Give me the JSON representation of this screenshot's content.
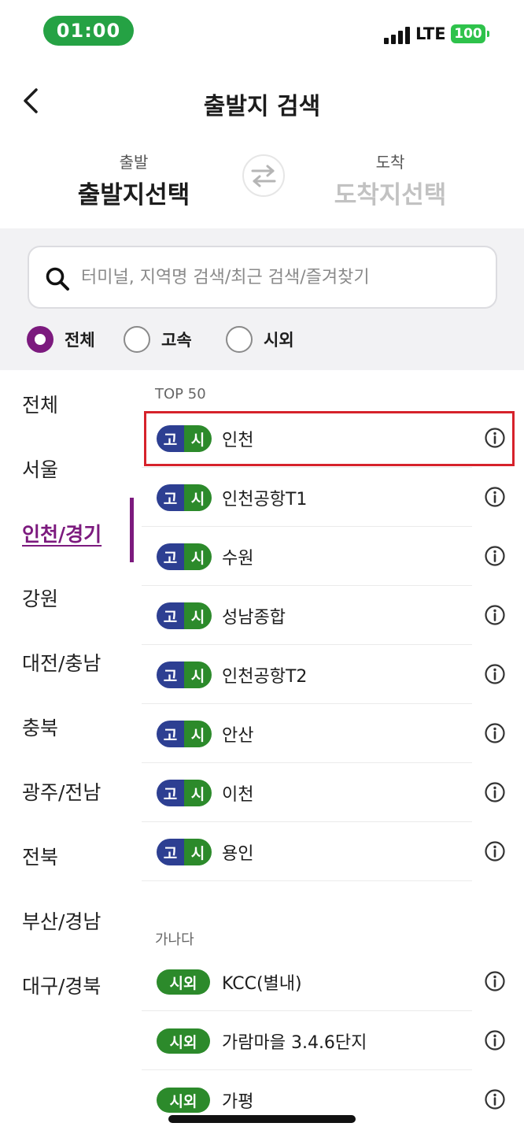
{
  "status_bar": {
    "time": "01:00",
    "network": "LTE",
    "battery": "100"
  },
  "header": {
    "title": "출발지 검색"
  },
  "route": {
    "departure_label": "출발",
    "departure_value": "출발지선택",
    "arrival_label": "도착",
    "arrival_value": "도착지선택"
  },
  "search": {
    "placeholder": "터미널, 지역명 검색/최근 검색/즐겨찾기"
  },
  "filters": [
    {
      "label": "전체",
      "selected": true
    },
    {
      "label": "고속",
      "selected": false
    },
    {
      "label": "시외",
      "selected": false
    }
  ],
  "regions": [
    {
      "label": "전체",
      "active": false
    },
    {
      "label": "서울",
      "active": false
    },
    {
      "label": "인천/경기",
      "active": true
    },
    {
      "label": "강원",
      "active": false
    },
    {
      "label": "대전/충남",
      "active": false
    },
    {
      "label": "충북",
      "active": false
    },
    {
      "label": "광주/전남",
      "active": false
    },
    {
      "label": "전북",
      "active": false
    },
    {
      "label": "부산/경남",
      "active": false
    },
    {
      "label": "대구/경북",
      "active": false
    }
  ],
  "badges": {
    "express": "고",
    "intercity": "시",
    "intercity_only": "시외"
  },
  "colors": {
    "accent": "#7c1a7e",
    "express_badge": "#2d3f92",
    "intercity_badge": "#2c8a2b",
    "highlight": "#d6222b",
    "time_pill": "#25a244"
  },
  "sections": {
    "top50": {
      "header": "TOP 50",
      "items": [
        {
          "name": "인천",
          "type": "both",
          "highlighted": true
        },
        {
          "name": "인천공항T1",
          "type": "both"
        },
        {
          "name": "수원",
          "type": "both"
        },
        {
          "name": "성남종합",
          "type": "both"
        },
        {
          "name": "인천공항T2",
          "type": "both"
        },
        {
          "name": "안산",
          "type": "both"
        },
        {
          "name": "이천",
          "type": "both"
        },
        {
          "name": "용인",
          "type": "both"
        }
      ]
    },
    "ganada": {
      "header": "가나다",
      "items": [
        {
          "name": "KCC(별내)",
          "type": "intercity"
        },
        {
          "name": "가람마을 3.4.6단지",
          "type": "intercity"
        },
        {
          "name": "가평",
          "type": "intercity"
        }
      ]
    }
  }
}
